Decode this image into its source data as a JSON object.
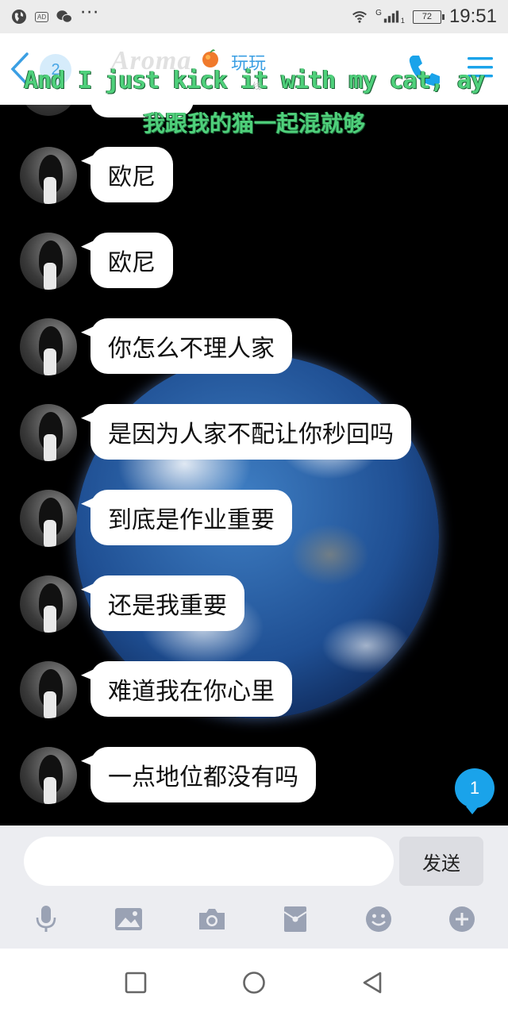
{
  "status_bar": {
    "ad_label": "AD",
    "more_dots": "···",
    "network_type": "G",
    "signal_sub": "1",
    "battery_level": "72",
    "time": "19:51"
  },
  "header": {
    "unread_count": "2",
    "logo_text": "Aroma",
    "title": "玩玩",
    "tiny_mark": "线"
  },
  "lyrics": {
    "english": "And I just kick it with my cat, ay",
    "chinese": "我跟我的猫一起混就够"
  },
  "messages": [
    "欧尼",
    "欧尼",
    "你怎么不理人家",
    "是因为人家不配让你秒回吗",
    "到底是作业重要",
    "还是我重要",
    "难道我在你心里",
    "一点地位都没有吗"
  ],
  "new_message_count": "1",
  "input": {
    "placeholder": "",
    "send_label": "发送"
  },
  "toolbar_icons": [
    "microphone-icon",
    "image-icon",
    "camera-icon",
    "red-packet-icon",
    "emoji-icon",
    "plus-icon"
  ],
  "nav_icons": [
    "square-icon",
    "circle-icon",
    "triangle-back-icon"
  ],
  "colors": {
    "accent": "#3b9fe3",
    "badge": "#1aa3ea",
    "lyric_green": "#4fd07b",
    "chat_bg": "#000000",
    "input_bg": "#ecedf1"
  }
}
